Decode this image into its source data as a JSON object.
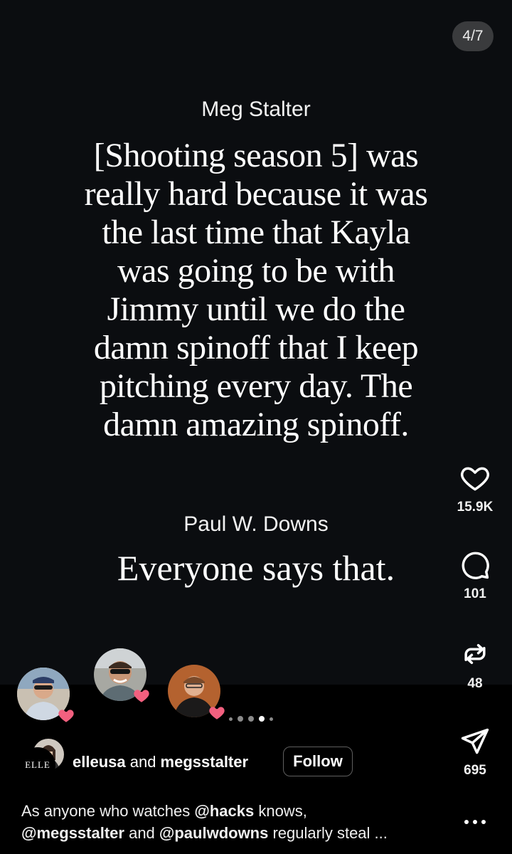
{
  "slide": {
    "counter": "4/7",
    "speaker_1": "Meg Stalter",
    "quote_lines": [
      "[Shooting season 5] was",
      "really hard because it was",
      "the last time that Kayla",
      "was going to be with",
      "Jimmy until we do the",
      "damn spinoff that I keep",
      "pitching every day. The",
      "damn amazing spinoff."
    ],
    "speaker_2": "Paul W. Downs",
    "reply": "Everyone says that."
  },
  "actions": {
    "like_count": "15.9K",
    "comment_count": "101",
    "repost_count": "48",
    "share_count": "695"
  },
  "carousel": {
    "total_dots": 5,
    "active_index": 3
  },
  "post": {
    "account_logo_text": "ELLE",
    "author_1": "elleusa",
    "author_joiner": " and ",
    "author_2": "megsstalter",
    "follow_label": "Follow",
    "caption_prefix": "As anyone who watches ",
    "mention_1": "@hacks",
    "caption_mid_1": " knows,",
    "mention_2": "@megsstalter",
    "caption_mid_2": " and ",
    "mention_3": "@paulwdowns",
    "caption_suffix": " regularly steal ..."
  },
  "icons": {
    "like": "heart-icon",
    "comment": "speech-bubble-icon",
    "repost": "repost-icon",
    "share": "paper-plane-icon",
    "more": "more-horizontal-icon",
    "reaction_badge": "pink-heart-badge"
  },
  "colors": {
    "slide_bg": "#0b0d10",
    "page_bg": "#000000",
    "heart_badge": "#f2607f"
  }
}
